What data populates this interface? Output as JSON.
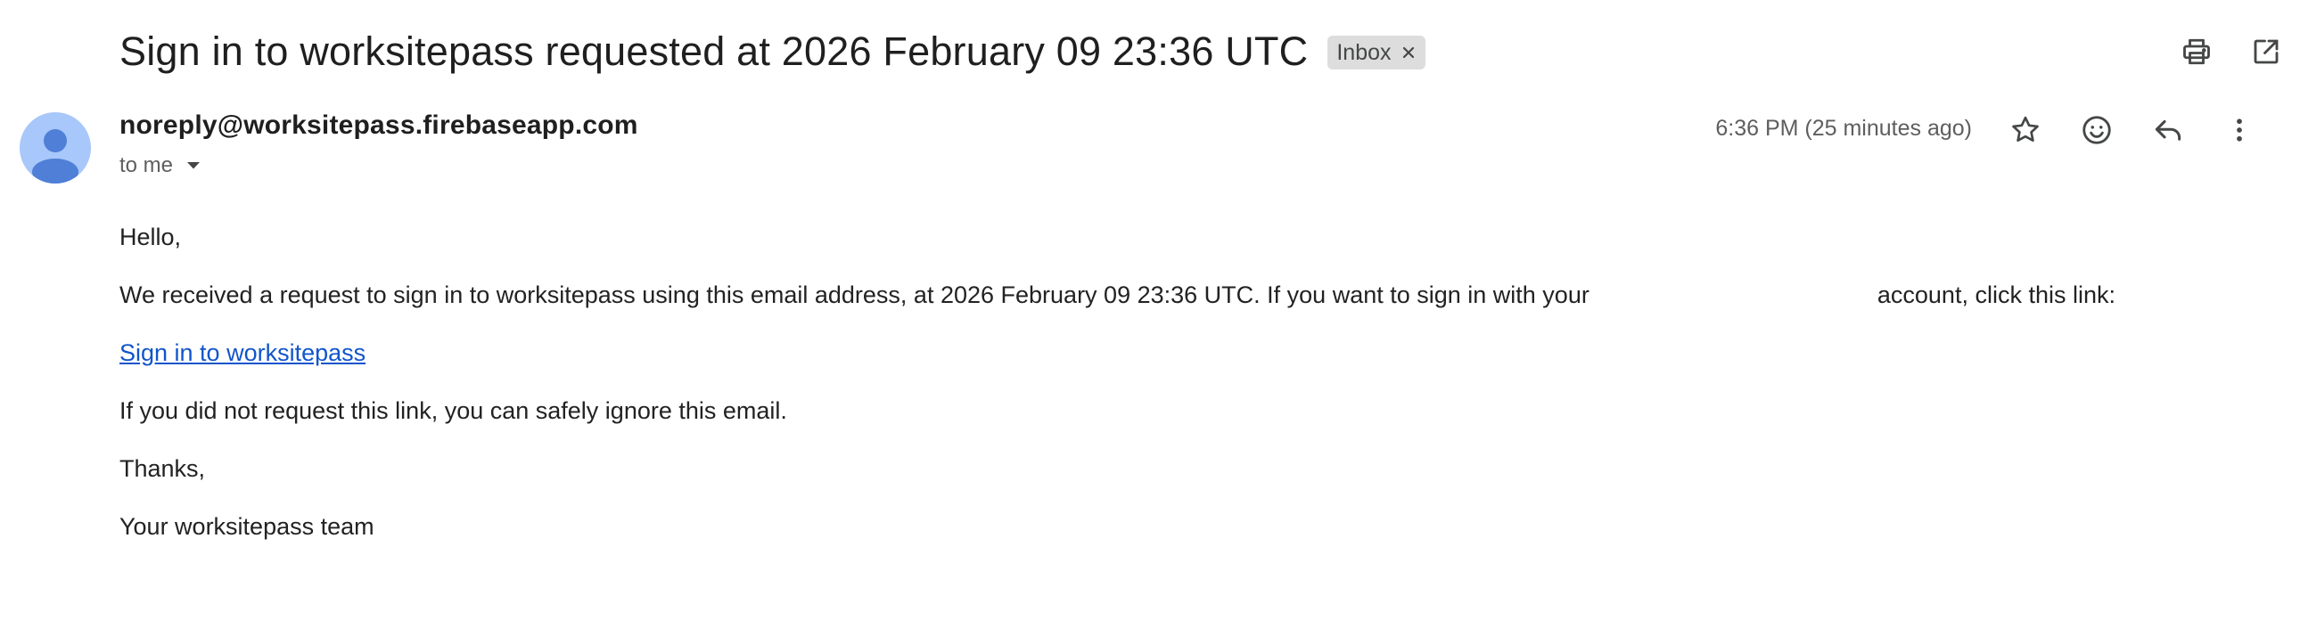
{
  "email": {
    "subject": "Sign in to worksitepass requested at 2026 February 09 23:36 UTC",
    "label": "Inbox",
    "sender": "noreply@worksitepass.firebaseapp.com",
    "recipient": "to me",
    "timestamp": "6:36 PM (25 minutes ago)"
  },
  "icons": {
    "print": "print-icon",
    "open_new_window": "open-in-new-window-icon",
    "star": "star-icon",
    "emoji": "emoji-reaction-icon",
    "reply": "reply-icon",
    "more": "more-vertical-icon",
    "label_remove": "close-icon",
    "recipients_dropdown": "caret-down-icon",
    "avatar": "person-avatar-icon"
  },
  "body": {
    "greeting": "Hello,",
    "request_text_before": "We received a request to sign in to worksitepass using this email address, at 2026 February 09 23:36 UTC. If you want to sign in with your",
    "request_text_after": "account, click this link:",
    "link_text": "Sign in to worksitepass",
    "ignore_text": "If you did not request this link, you can safely ignore this email.",
    "thanks": "Thanks,",
    "signature": "Your worksitepass team"
  },
  "colors": {
    "link": "#1155cc",
    "avatar_bg": "#a8c7fa",
    "avatar_fg": "#4f7fd6",
    "label_chip_bg": "#dddddd",
    "secondary_text": "#5e5e5e"
  }
}
